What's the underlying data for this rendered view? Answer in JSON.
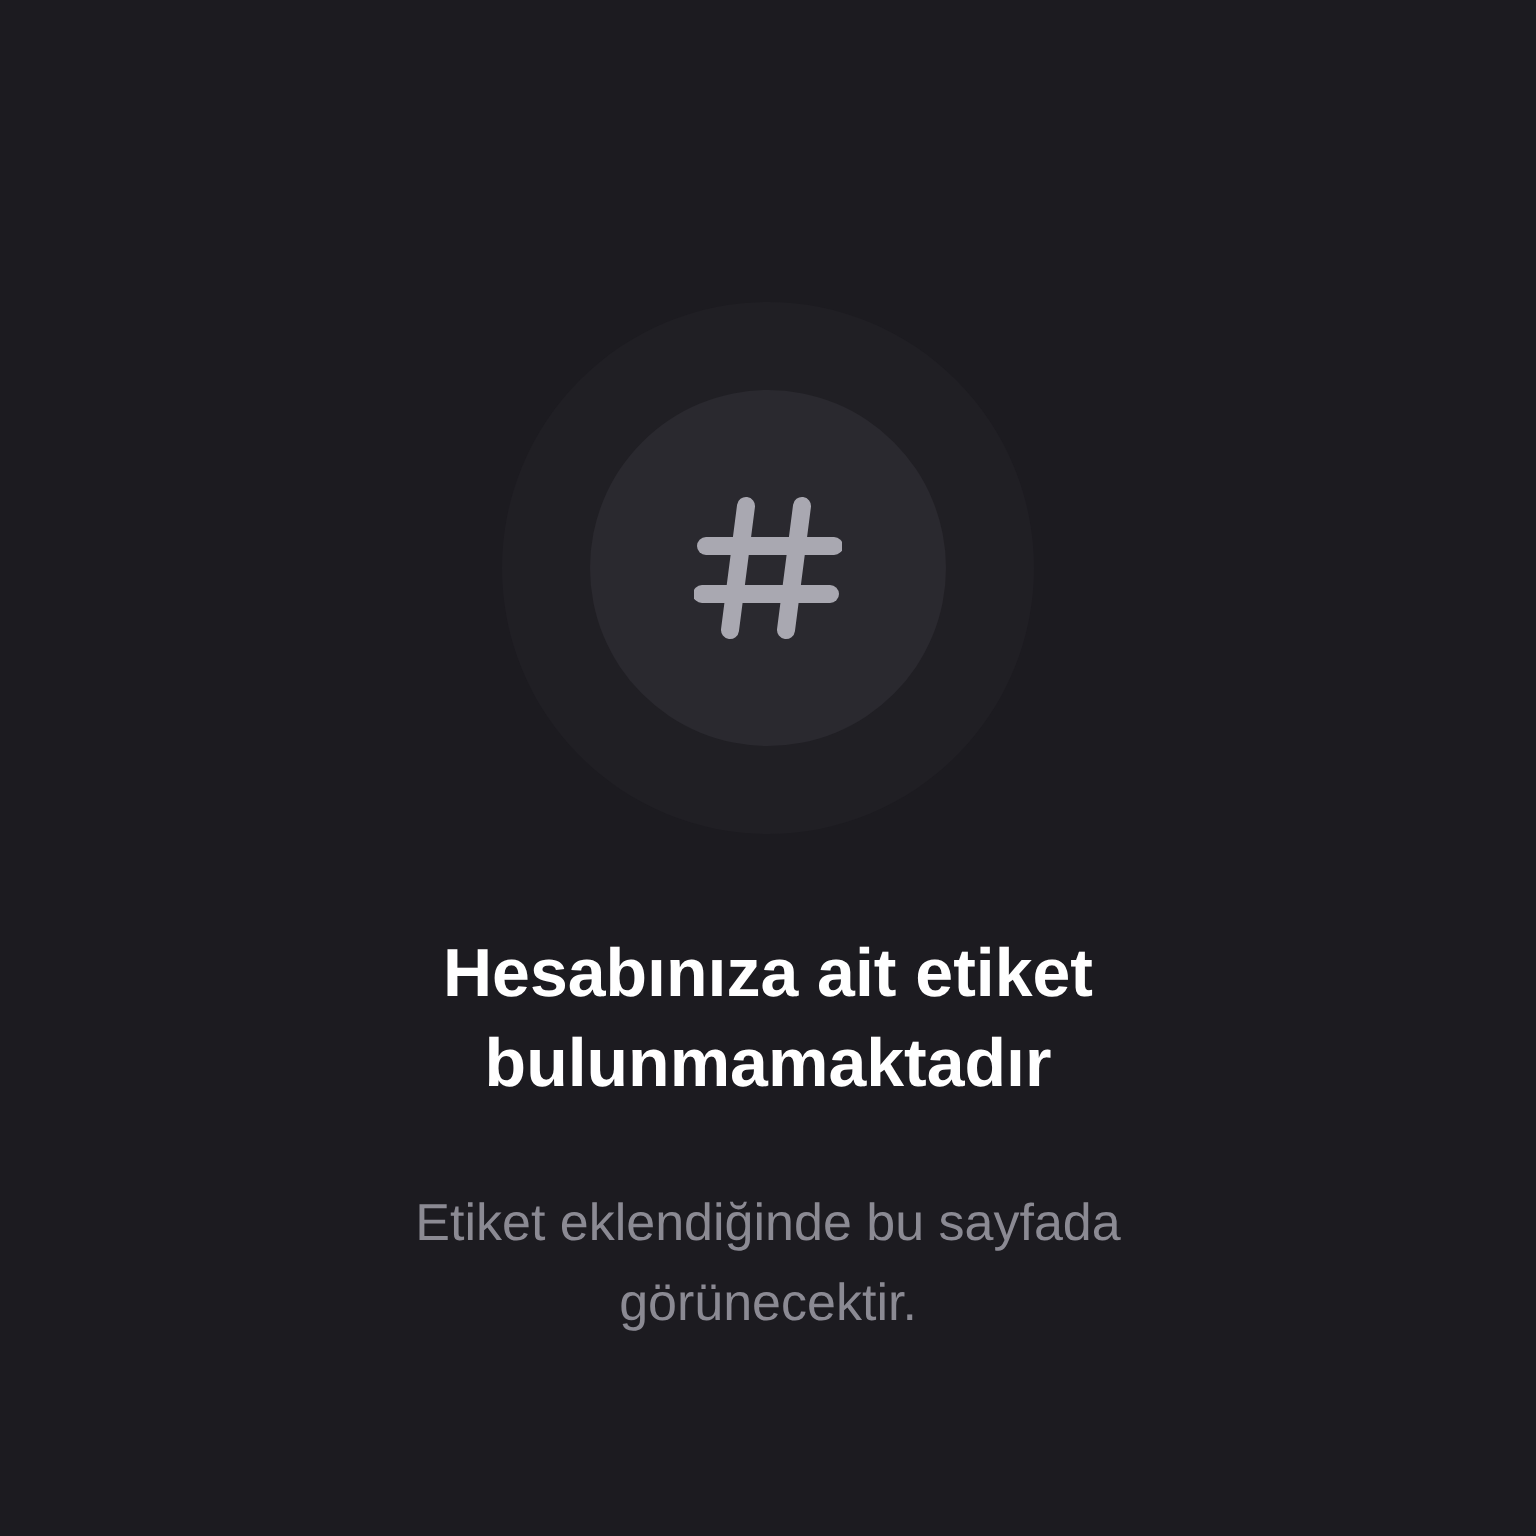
{
  "empty_state": {
    "title": "Hesabınıza ait etiket bulunmamaktadır",
    "message": "Etiket eklendiğinde bu sayfada görünecektir."
  }
}
